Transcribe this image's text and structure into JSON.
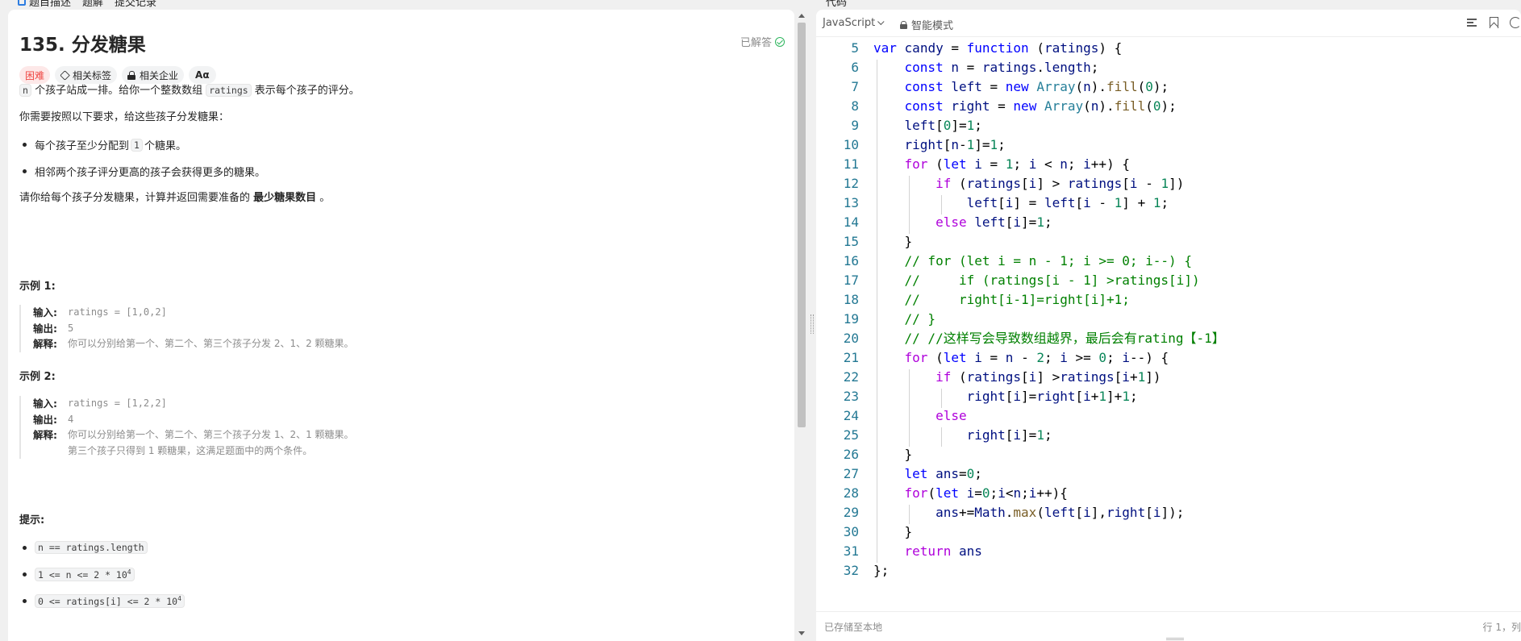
{
  "top_bar": {
    "left_tabs": [
      "题目描述",
      "题解",
      "提交记录"
    ],
    "right_tab": "代码"
  },
  "problem": {
    "title": "135. 分发糖果",
    "solved_label": "已解答",
    "tags": {
      "difficulty": "困难",
      "related_tags": "相关标签",
      "related_companies": "相关企业",
      "font_button": "Aα"
    },
    "description": {
      "p1_code": "n",
      "p1_mid": " 个孩子站成一排。给你一个整数数组 ",
      "p1_code2": "ratings",
      "p1_end": " 表示每个孩子的评分。",
      "p2": "你需要按照以下要求，给这些孩子分发糖果：",
      "bullet1_pre": "每个孩子至少分配到 ",
      "bullet1_code": "1",
      "bullet1_post": " 个糖果。",
      "bullet2": "相邻两个孩子评分更高的孩子会获得更多的糖果。",
      "p3_pre": "请你给每个孩子分发糖果，计算并返回需要准备的 ",
      "p3_bold": "最少糖果数目",
      "p3_post": " 。"
    },
    "examples": [
      {
        "title": "示例 1:",
        "input_label": "输入:",
        "input": "ratings = [1,0,2]",
        "output_label": "输出:",
        "output": "5",
        "explain_label": "解释:",
        "explain": [
          "你可以分别给第一个、第二个、第三个孩子分发 2、1、2 颗糖果。"
        ]
      },
      {
        "title": "示例 2:",
        "input_label": "输入:",
        "input": "ratings = [1,2,2]",
        "output_label": "输出:",
        "output": "4",
        "explain_label": "解释:",
        "explain": [
          "你可以分别给第一个、第二个、第三个孩子分发 1、2、1 颗糖果。",
          "第三个孩子只得到 1 颗糖果，这满足题面中的两个条件。"
        ]
      }
    ],
    "hints_title": "提示:",
    "constraints": [
      "n == ratings.length",
      "1 <= n <= 2 * 10",
      "0 <= ratings[i] <= 2 * 10"
    ],
    "constraint_sup": "4"
  },
  "editor": {
    "language": "JavaScript",
    "mode": "智能模式",
    "status_saved": "已存储至本地",
    "cursor_position": "行 1，列",
    "lines": [
      {
        "n": "5",
        "html": "<span class='k'>var</span> <span class='v'>candy</span> = <span class='k'>function</span> (<span class='v'>ratings</span>) {"
      },
      {
        "n": "6",
        "html": "    <span class='k'>const</span> <span class='v'>n</span> = <span class='v'>ratings</span>.<span class='v'>length</span>;"
      },
      {
        "n": "7",
        "html": "    <span class='k'>const</span> <span class='v'>left</span> = <span class='k'>new</span> <span class='t'>Array</span>(<span class='v'>n</span>).<span class='f'>fill</span>(<span class='n'>0</span>);"
      },
      {
        "n": "8",
        "html": "    <span class='k'>const</span> <span class='v'>right</span> = <span class='k'>new</span> <span class='t'>Array</span>(<span class='v'>n</span>).<span class='f'>fill</span>(<span class='n'>0</span>);"
      },
      {
        "n": "9",
        "html": "    <span class='v'>left</span>[<span class='n'>0</span>]=<span class='n'>1</span>;"
      },
      {
        "n": "10",
        "html": "    <span class='v'>right</span>[<span class='v'>n</span>-<span class='n'>1</span>]=<span class='n'>1</span>;"
      },
      {
        "n": "11",
        "html": "    <span class='kc'>for</span> (<span class='k'>let</span> <span class='v'>i</span> = <span class='n'>1</span>; <span class='v'>i</span> &lt; <span class='v'>n</span>; <span class='v'>i</span>++) {"
      },
      {
        "n": "12",
        "html": "        <span class='kc'>if</span> (<span class='v'>ratings</span>[<span class='v'>i</span>] &gt; <span class='v'>ratings</span>[<span class='v'>i</span> - <span class='n'>1</span>])"
      },
      {
        "n": "13",
        "html": "            <span class='v'>left</span>[<span class='v'>i</span>] = <span class='v'>left</span>[<span class='v'>i</span> - <span class='n'>1</span>] + <span class='n'>1</span>;"
      },
      {
        "n": "14",
        "html": "        <span class='kc'>else</span> <span class='v'>left</span>[<span class='v'>i</span>]=<span class='n'>1</span>;"
      },
      {
        "n": "15",
        "html": "    }"
      },
      {
        "n": "16",
        "html": "    <span class='c'>// for (let i = n - 1; i &gt;= 0; i--) {</span>"
      },
      {
        "n": "17",
        "html": "    <span class='c'>//     if (ratings[i - 1] &gt;ratings[i])</span>"
      },
      {
        "n": "18",
        "html": "    <span class='c'>//     right[i-1]=right[i]+1;</span>"
      },
      {
        "n": "19",
        "html": "    <span class='c'>// }</span>"
      },
      {
        "n": "20",
        "html": "    <span class='c'>// //这样写会导致数组越界，最后会有rating【-1】</span>"
      },
      {
        "n": "21",
        "html": "    <span class='kc'>for</span> (<span class='k'>let</span> <span class='v'>i</span> = <span class='v'>n</span> - <span class='n'>2</span>; <span class='v'>i</span> &gt;= <span class='n'>0</span>; <span class='v'>i</span>--) {"
      },
      {
        "n": "22",
        "html": "        <span class='kc'>if</span> (<span class='v'>ratings</span>[<span class='v'>i</span>] &gt;<span class='v'>ratings</span>[<span class='v'>i</span>+<span class='n'>1</span>])"
      },
      {
        "n": "23",
        "html": "            <span class='v'>right</span>[<span class='v'>i</span>]=<span class='v'>right</span>[<span class='v'>i</span>+<span class='n'>1</span>]+<span class='n'>1</span>;"
      },
      {
        "n": "24",
        "html": "        <span class='kc'>else</span>"
      },
      {
        "n": "25",
        "html": "            <span class='v'>right</span>[<span class='v'>i</span>]=<span class='n'>1</span>;"
      },
      {
        "n": "26",
        "html": "    }"
      },
      {
        "n": "27",
        "html": "    <span class='k'>let</span> <span class='v'>ans</span>=<span class='n'>0</span>;"
      },
      {
        "n": "28",
        "html": "    <span class='kc'>for</span>(<span class='k'>let</span> <span class='v'>i</span>=<span class='n'>0</span>;<span class='v'>i</span>&lt;<span class='v'>n</span>;<span class='v'>i</span>++){"
      },
      {
        "n": "29",
        "html": "        <span class='v'>ans</span>+=<span class='v'>Math</span>.<span class='f'>max</span>(<span class='v'>left</span>[<span class='v'>i</span>],<span class='v'>right</span>[<span class='v'>i</span>]);"
      },
      {
        "n": "30",
        "html": "    }"
      },
      {
        "n": "31",
        "html": "    <span class='kc'>return</span> <span class='v'>ans</span>"
      },
      {
        "n": "32",
        "html": "};"
      }
    ]
  },
  "colors": {
    "hard_tag": "#ef4743",
    "solved_check": "#2db55d",
    "line_number": "#237893",
    "keyword": "#0000ff",
    "control_keyword": "#af00db",
    "comment": "#008000"
  }
}
